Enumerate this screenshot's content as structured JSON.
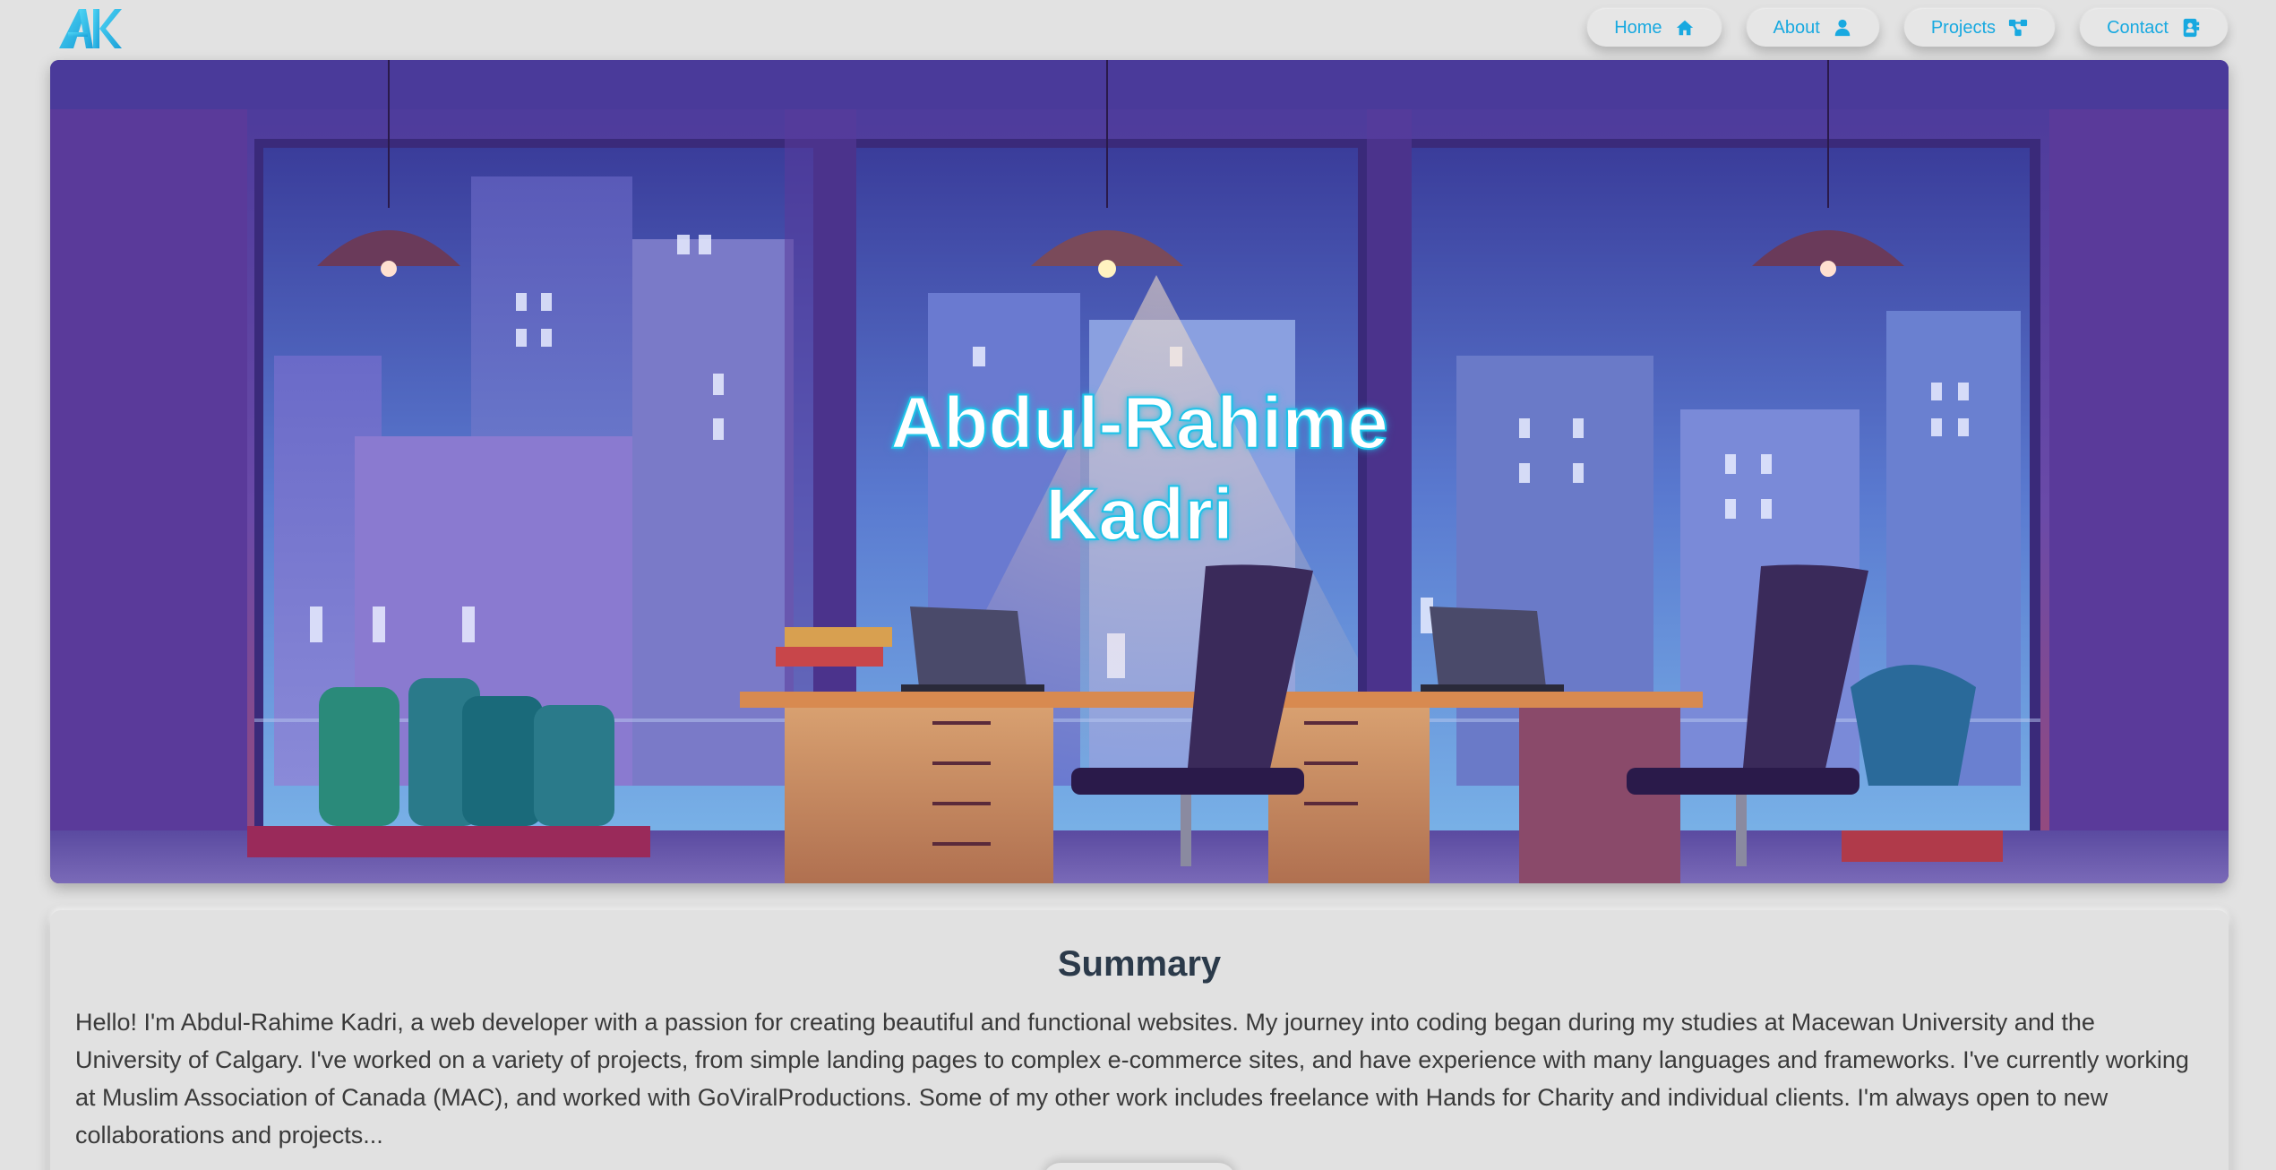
{
  "header": {
    "logo_text": "AK",
    "nav": [
      {
        "label": "Home",
        "icon": "home-icon"
      },
      {
        "label": "About",
        "icon": "user-icon"
      },
      {
        "label": "Projects",
        "icon": "share-nodes-icon"
      },
      {
        "label": "Contact",
        "icon": "contact-book-icon"
      }
    ]
  },
  "hero": {
    "name_line1": "Abdul-Rahime",
    "name_line2": "Kadri",
    "background": "office-night-city-illustration"
  },
  "summary": {
    "title": "Summary",
    "text": "Hello! I'm Abdul-Rahime Kadri, a web developer with a passion for creating beautiful and functional websites. My journey into coding began during my studies at Macewan University and the University of Calgary. I've worked on a variety of projects, from simple landing pages to complex e-commerce sites, and have experience with many languages and frameworks. I've currently working at Muslim Association of Canada (MAC), and worked with GoViralProductions. Some of my other work includes freelance with Hands for Charity and individual clients. I'm always open to new collaborations and projects..."
  },
  "colors": {
    "accent": "#18a9e0",
    "background": "#e2e2e2",
    "heading": "#2b3a4a"
  }
}
